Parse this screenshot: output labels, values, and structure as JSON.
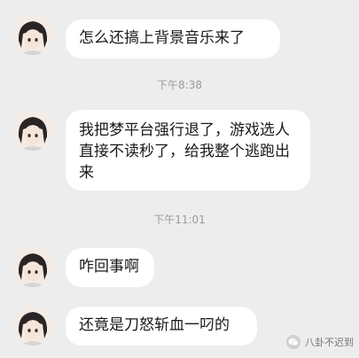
{
  "messages": [
    {
      "text": "怎么还搞上背景音乐来了"
    },
    {
      "text": "我把梦平台强行退了，游戏选人直接不读秒了，给我整个逃跑出来"
    },
    {
      "text": "咋回事啊"
    },
    {
      "text": "还竟是刀怒斩血一叼的"
    }
  ],
  "timestamps": [
    "下午8:38",
    "下午11:01"
  ],
  "watermark": {
    "text": "八卦不迟到",
    "icon": "wechat-icon"
  },
  "colors": {
    "background": "#ededed",
    "bubble": "#ffffff",
    "timestamp": "#9a9a9a"
  }
}
